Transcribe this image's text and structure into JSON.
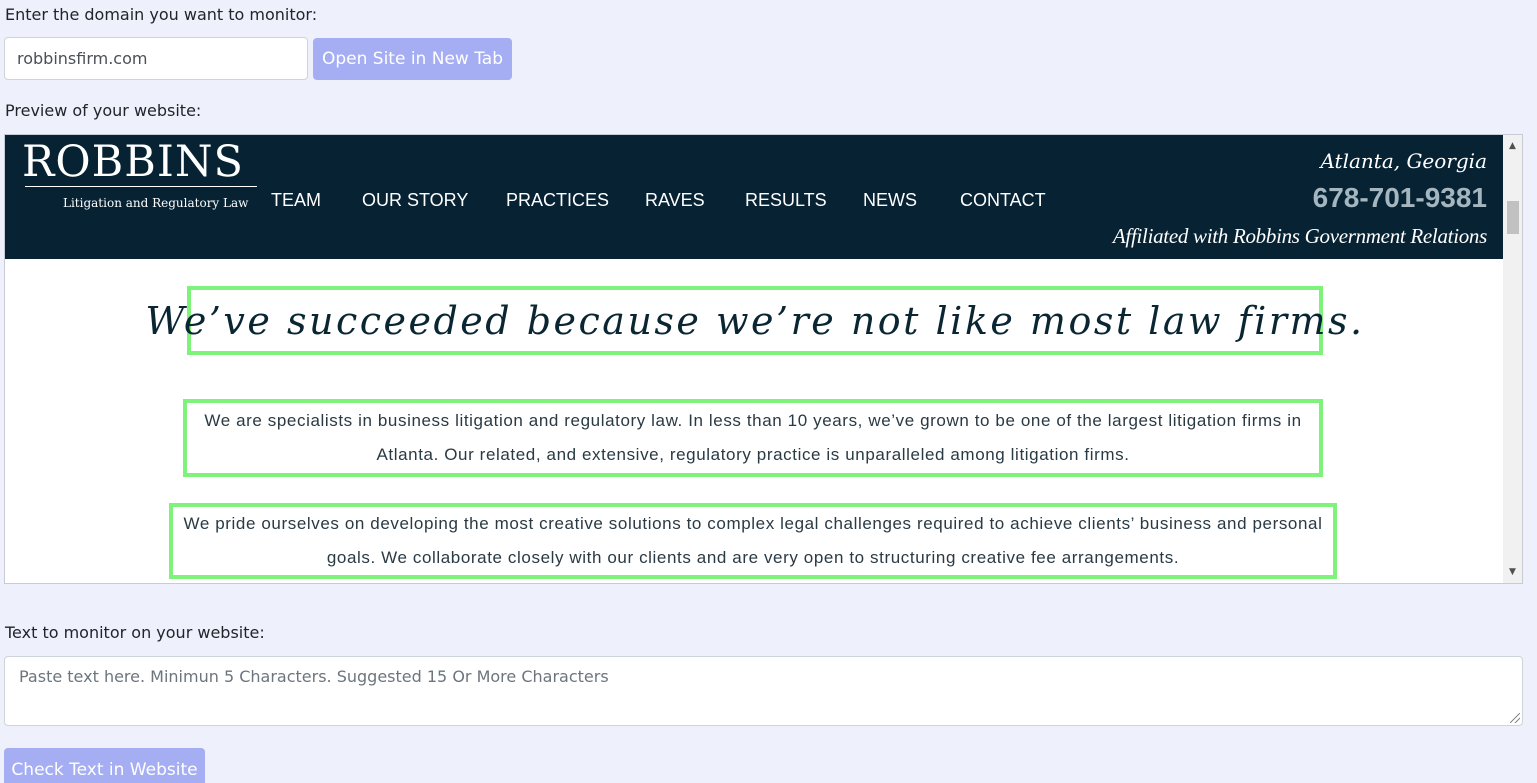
{
  "form": {
    "domain_label": "Enter the domain you want to monitor:",
    "domain_value": "robbinsfirm.com",
    "open_button": "Open Site in New Tab",
    "preview_label": "Preview of your website:",
    "monitor_label": "Text to monitor on your website:",
    "monitor_placeholder": "Paste text here. Minimun 5 Characters. Suggested 15 Or More Characters",
    "check_button": "Check Text in Website"
  },
  "preview": {
    "logo_name": "ROBBINS",
    "logo_tagline": "Litigation and Regulatory Law",
    "nav": [
      "TEAM",
      "OUR STORY",
      "PRACTICES",
      "RAVES",
      "RESULTS",
      "NEWS",
      "CONTACT"
    ],
    "location": "Atlanta, Georgia",
    "phone": "678-701-9381",
    "affiliation": "Affiliated with Robbins Government Relations",
    "headline": "We’ve succeeded because we’re not like most law firms.",
    "paragraph1": "We are specialists in business litigation and regulatory law. In less than 10 years, we’ve grown to be one of the largest litigation firms in Atlanta. Our related, and extensive, regulatory practice is unparalleled among litigation firms.",
    "paragraph2": "We pride ourselves on developing the most creative solutions to complex legal challenges required to achieve clients’ business and personal goals. We collaborate closely with our clients and are very open to structuring creative fee arrangements."
  },
  "colors": {
    "page_background": "#eef0fb",
    "button": "#a5adf3",
    "site_header": "#062233",
    "phone": "#a4b6bf",
    "highlight_border": "#7ef27b"
  }
}
